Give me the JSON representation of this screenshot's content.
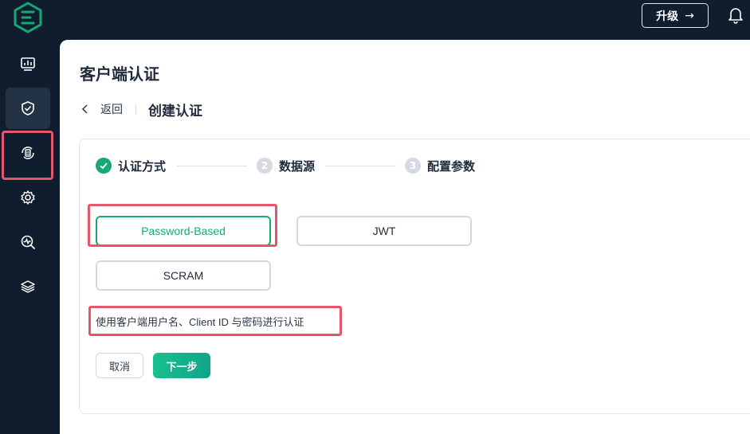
{
  "header": {
    "upgrade_label": "升级",
    "upgrade_arrow": "→"
  },
  "sidebar": {
    "items": [
      {
        "icon": "dashboard-icon"
      },
      {
        "icon": "shield-check-icon",
        "active": true
      },
      {
        "icon": "data-sync-icon"
      },
      {
        "icon": "gear-icon"
      },
      {
        "icon": "diagnose-icon"
      },
      {
        "icon": "layers-icon"
      }
    ]
  },
  "page": {
    "title": "客户端认证",
    "back_label": "返回",
    "subtitle": "创建认证"
  },
  "steps": [
    {
      "number": "",
      "label": "认证方式",
      "status": "done"
    },
    {
      "number": "2",
      "label": "数据源",
      "status": "pending"
    },
    {
      "number": "3",
      "label": "配置参数",
      "status": "pending"
    }
  ],
  "options": [
    {
      "label": "Password-Based",
      "selected": true
    },
    {
      "label": "JWT",
      "selected": false
    },
    {
      "label": "SCRAM",
      "selected": false
    }
  ],
  "description": "使用客户端用户名、Client ID 与密码进行认证",
  "actions": {
    "cancel_label": "取消",
    "next_label": "下一步"
  },
  "colors": {
    "sidebar_bg": "#0f1d2e",
    "accent": "#18a874",
    "highlight": "#e5566b"
  }
}
